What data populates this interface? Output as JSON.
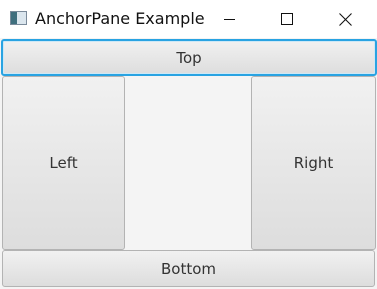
{
  "window": {
    "title": "AnchorPane Example",
    "controls": {
      "minimize_icon": "minimize-icon",
      "maximize_icon": "maximize-icon",
      "close_icon": "close-icon"
    }
  },
  "buttons": {
    "top": "Top",
    "left": "Left",
    "right": "Right",
    "bottom": "Bottom"
  },
  "colors": {
    "focus_ring": "#29a3e2",
    "background": "#f4f4f4"
  }
}
